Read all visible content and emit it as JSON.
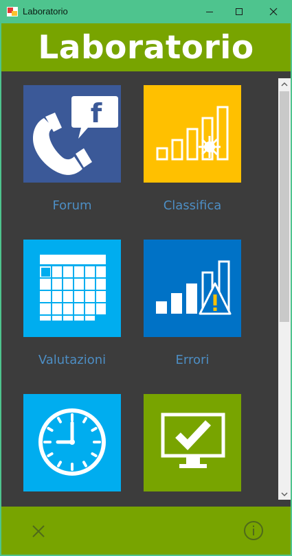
{
  "window": {
    "title": "Laboratorio",
    "controls": {
      "minimize": "minimize-icon",
      "maximize": "maximize-icon",
      "close": "close-icon"
    }
  },
  "header": {
    "title": "Laboratorio"
  },
  "tiles": [
    {
      "label": "Forum",
      "icon": "phone-facebook-icon",
      "color": "#3b5998"
    },
    {
      "label": "Classifica",
      "icon": "ranking-bars-icon",
      "color": "#ffc000"
    },
    {
      "label": "Valutazioni",
      "icon": "calendar-icon",
      "color": "#00adef"
    },
    {
      "label": "Errori",
      "icon": "error-bars-warning-icon",
      "color": "#0072c6"
    },
    {
      "label": "",
      "icon": "clock-icon",
      "color": "#00adef"
    },
    {
      "label": "",
      "icon": "monitor-check-icon",
      "color": "#78a400"
    }
  ],
  "footer": {
    "close_icon": "close-icon",
    "info_icon": "info-icon"
  },
  "colors": {
    "accent": "#78a400",
    "titlebar": "#4ec48e",
    "background": "#3c3c3c",
    "label": "#4d8ec4"
  }
}
